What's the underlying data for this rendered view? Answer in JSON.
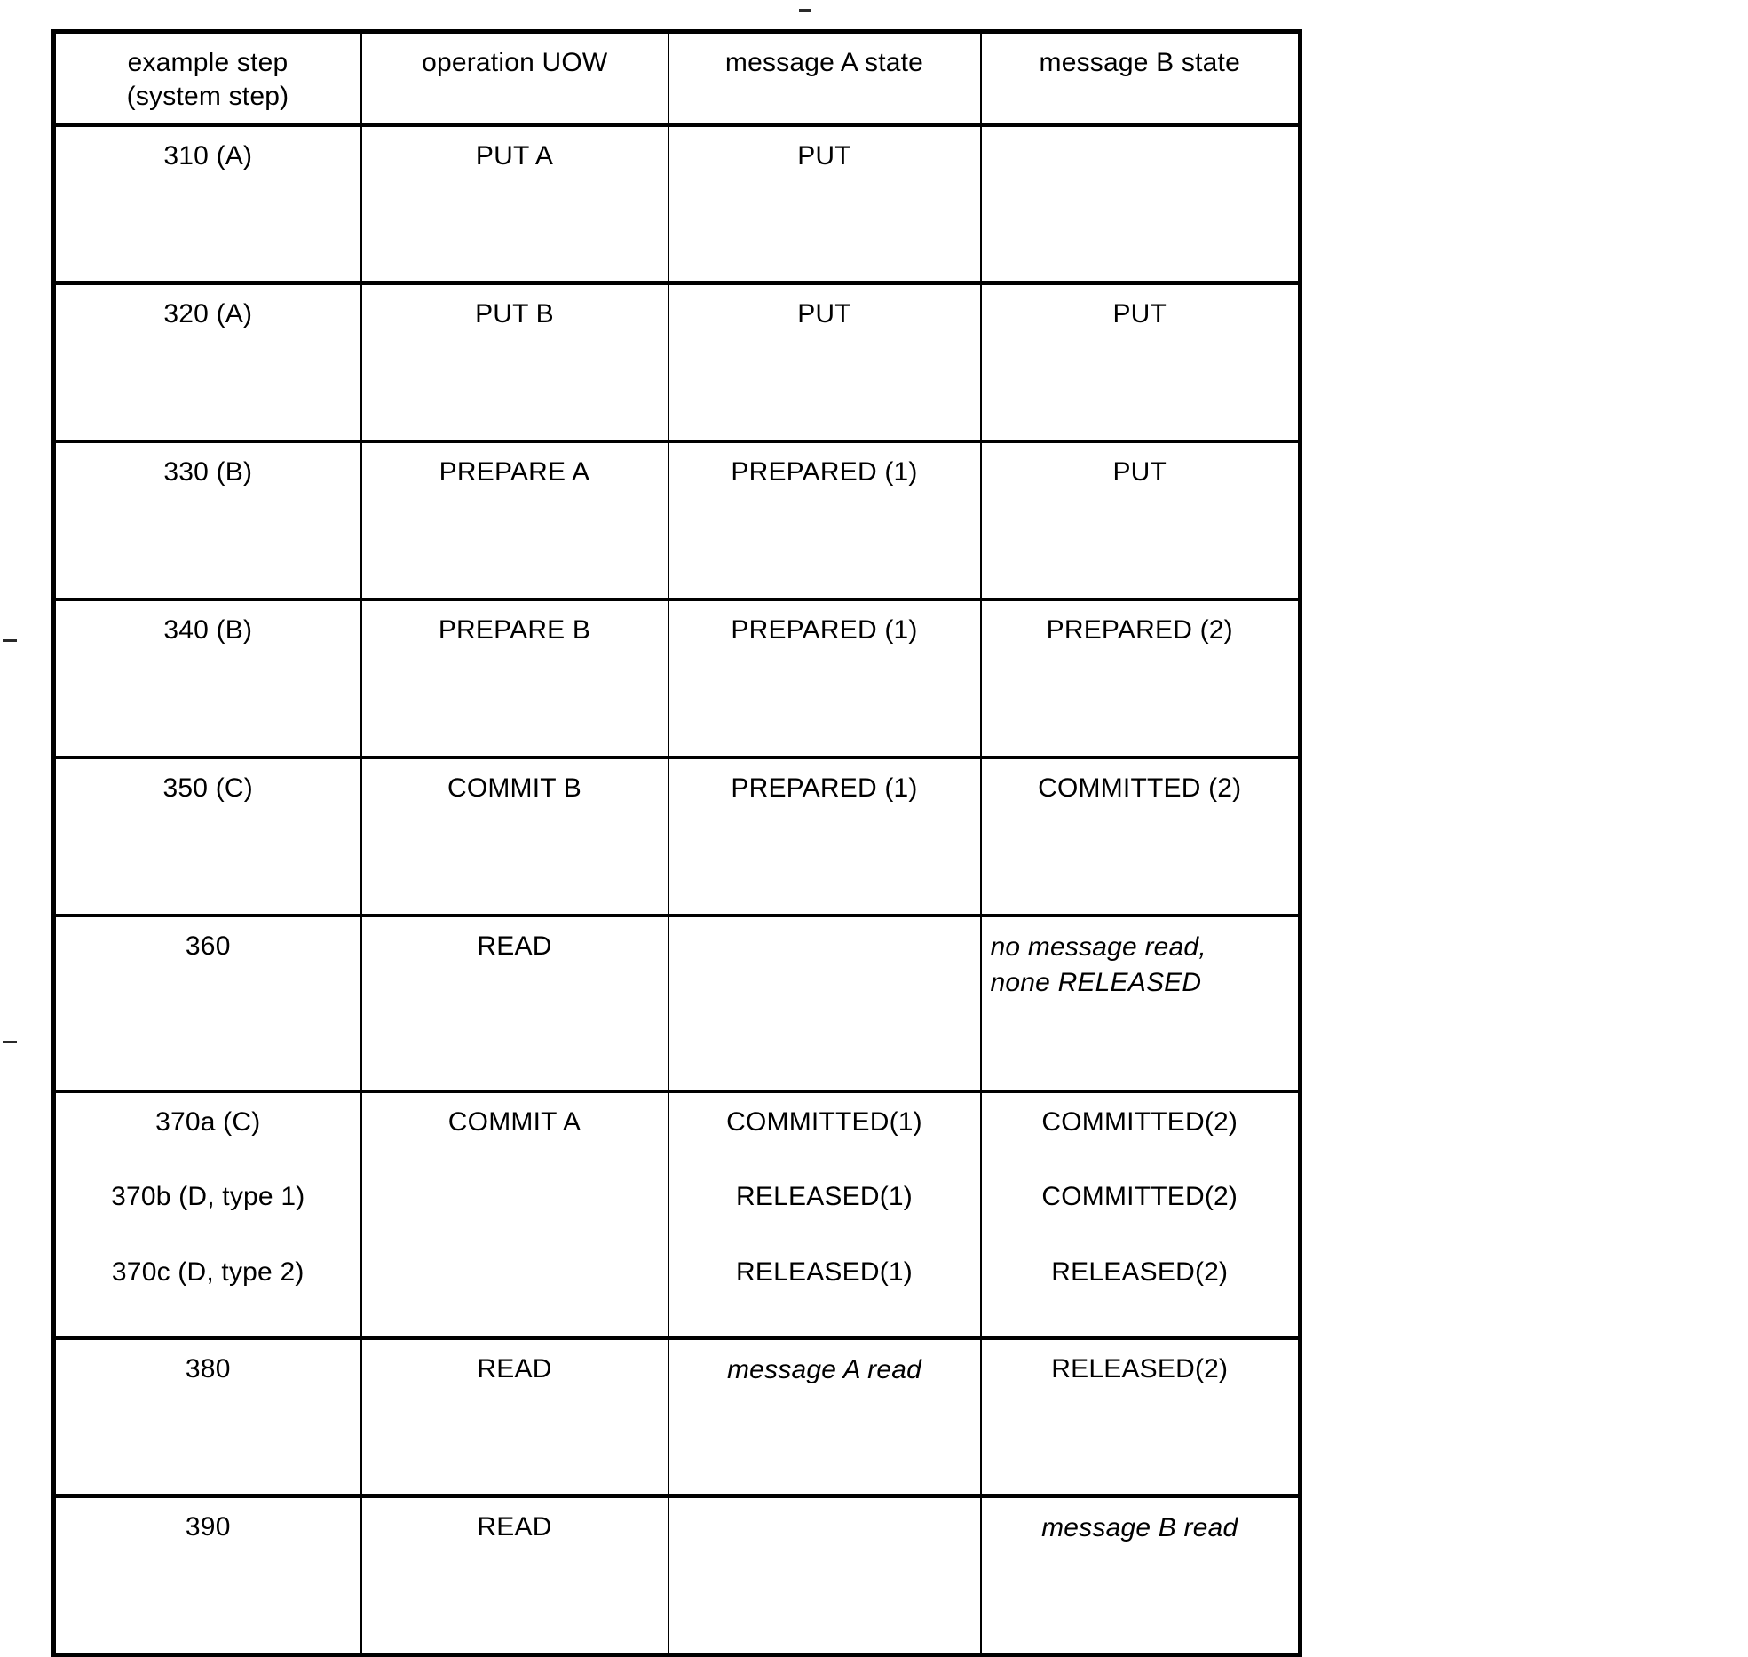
{
  "table": {
    "columns": [
      {
        "id": "step",
        "label_line1": "example step",
        "label_line2": "(system step)"
      },
      {
        "id": "uow",
        "label_line1": "operation UOW",
        "label_line2": ""
      },
      {
        "id": "msg_a",
        "label_line1": "message A state",
        "label_line2": ""
      },
      {
        "id": "msg_b",
        "label_line1": "message B state",
        "label_line2": ""
      }
    ],
    "rows": [
      {
        "step": "310 (A)",
        "uow": "PUT A",
        "msg_a": "PUT",
        "msg_b": ""
      },
      {
        "step": "320 (A)",
        "uow": "PUT B",
        "msg_a": "PUT",
        "msg_b": "PUT"
      },
      {
        "step": "330 (B)",
        "uow": "PREPARE A",
        "msg_a": "PREPARED (1)",
        "msg_b": "PUT"
      },
      {
        "step": "340 (B)",
        "uow": "PREPARE B",
        "msg_a": "PREPARED (1)",
        "msg_b": "PREPARED (2)"
      },
      {
        "step": "350 (C)",
        "uow": "COMMIT B",
        "msg_a": "PREPARED (1)",
        "msg_b": "COMMITTED (2)"
      },
      {
        "step": "360",
        "uow": "READ",
        "msg_a": "",
        "msg_b_line1": "no message read,",
        "msg_b_line2": "none RELEASED",
        "msg_b_italic": true
      },
      {
        "step_line1": "370a (C)",
        "step_line2": "370b (D, type 1)",
        "step_line3": "370c (D, type 2)",
        "uow_line1": "COMMIT A",
        "uow_line2": "",
        "uow_line3": "",
        "msg_a_line1": "COMMITTED(1)",
        "msg_a_line2": "RELEASED(1)",
        "msg_a_line3": "RELEASED(1)",
        "msg_b_line1": "COMMITTED(2)",
        "msg_b_line2": "COMMITTED(2)",
        "msg_b_line3": "RELEASED(2)"
      },
      {
        "step": "380",
        "uow": "READ",
        "msg_a": "message A read",
        "msg_a_italic": true,
        "msg_b": "RELEASED(2)"
      },
      {
        "step": "390",
        "uow": "READ",
        "msg_a": "",
        "msg_b": "message B read",
        "msg_b_italic": true
      }
    ]
  }
}
